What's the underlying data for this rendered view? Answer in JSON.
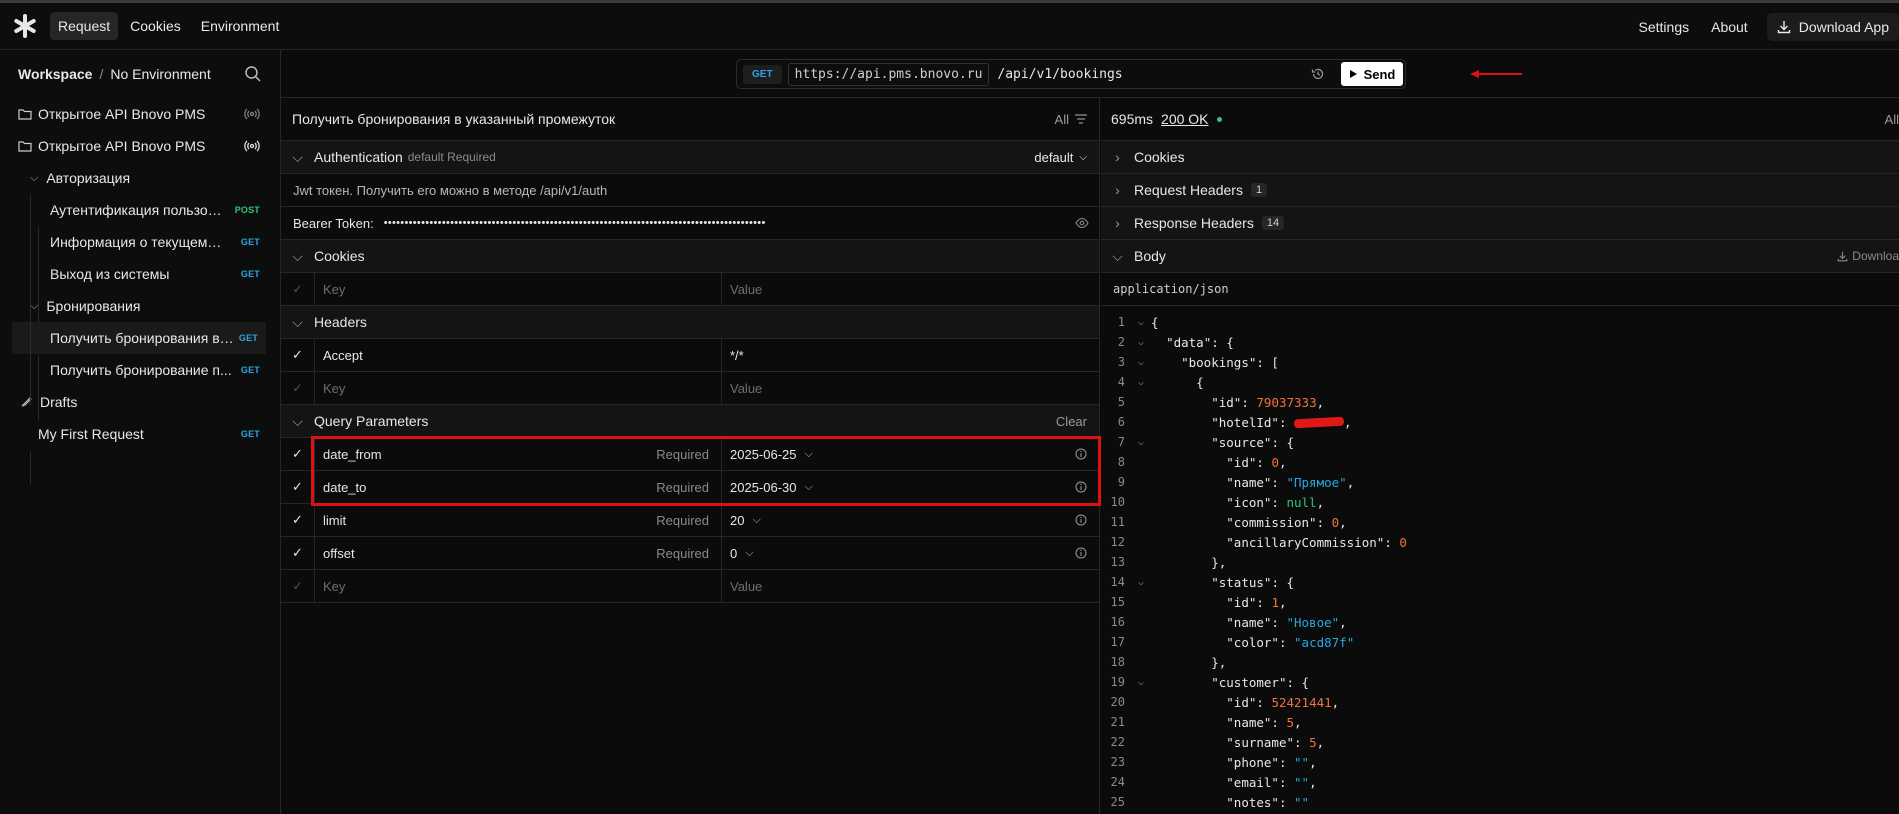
{
  "topbar": {
    "nav": [
      "Request",
      "Cookies",
      "Environment"
    ],
    "right": [
      "Settings",
      "About"
    ],
    "download_app": "Download App"
  },
  "sidebar": {
    "workspace": "Workspace",
    "separator": "/",
    "environment": "No Environment",
    "items": [
      {
        "label": "Открытое API Bnovo PMS",
        "type": "collection"
      },
      {
        "label": "Открытое API Bnovo PMS",
        "type": "collection"
      },
      {
        "label": "Авторизация",
        "type": "folder"
      },
      {
        "label": "Аутентификация пользов...",
        "method": "POST"
      },
      {
        "label": "Информация о текущем п...",
        "method": "GET"
      },
      {
        "label": "Выход из системы",
        "method": "GET"
      },
      {
        "label": "Бронирования",
        "type": "folder"
      },
      {
        "label": "Получить бронирования в ...",
        "method": "GET"
      },
      {
        "label": "Получить бронирование п...",
        "method": "GET"
      },
      {
        "label": "Drafts",
        "type": "drafts"
      },
      {
        "label": "My First Request",
        "method": "GET"
      }
    ]
  },
  "urlbar": {
    "method": "GET",
    "base": "https://api.pms.bnovo.ru",
    "path": "/api/v1/bookings",
    "send_label": "Send"
  },
  "request": {
    "title": "Получить бронирования в указанный промежуток",
    "filter_label": "All",
    "auth": {
      "title": "Authentication",
      "sub": "default Required",
      "mode": "default",
      "description": "Jwt токен. Получить его можно в методе /api/v1/auth",
      "bearer_label": "Bearer Token:",
      "bearer_value": "••••••••••••••••••••••••••••••••••••••••••••••••••••••••••••••••••••••••••••••••••••••••••••"
    },
    "cookies": {
      "title": "Cookies",
      "key_placeholder": "Key",
      "value_placeholder": "Value"
    },
    "headers": {
      "title": "Headers",
      "rows": [
        {
          "key": "Accept",
          "value": "*/*"
        }
      ],
      "key_placeholder": "Key",
      "value_placeholder": "Value"
    },
    "query": {
      "title": "Query Parameters",
      "clear_label": "Clear",
      "required_label": "Required",
      "rows": [
        {
          "key": "date_from",
          "value": "2025-06-25"
        },
        {
          "key": "date_to",
          "value": "2025-06-30"
        },
        {
          "key": "limit",
          "value": "20"
        },
        {
          "key": "offset",
          "value": "0"
        }
      ],
      "key_placeholder": "Key",
      "value_placeholder": "Value"
    }
  },
  "response": {
    "time": "695ms",
    "status": "200 OK",
    "filter_label": "All",
    "sections": {
      "cookies": "Cookies",
      "request_headers": "Request Headers",
      "request_headers_count": "1",
      "response_headers": "Response Headers",
      "response_headers_count": "14",
      "body": "Body",
      "download": "Downloa"
    },
    "content_type": "application/json",
    "json_lines": [
      {
        "n": "1",
        "fold": true,
        "indent": 0,
        "parts": [
          [
            "p",
            "{"
          ]
        ]
      },
      {
        "n": "2",
        "fold": true,
        "indent": 1,
        "parts": [
          [
            "k",
            "\"data\""
          ],
          [
            "p",
            ": {"
          ]
        ]
      },
      {
        "n": "3",
        "fold": true,
        "indent": 2,
        "parts": [
          [
            "k",
            "\"bookings\""
          ],
          [
            "p",
            ": ["
          ]
        ]
      },
      {
        "n": "4",
        "fold": true,
        "indent": 3,
        "parts": [
          [
            "p",
            "{"
          ]
        ]
      },
      {
        "n": "5",
        "fold": false,
        "indent": 4,
        "parts": [
          [
            "k",
            "\"id\""
          ],
          [
            "p",
            ": "
          ],
          [
            "n",
            "79037333"
          ],
          [
            "p",
            ","
          ]
        ]
      },
      {
        "n": "6",
        "fold": false,
        "indent": 4,
        "parts": [
          [
            "k",
            "\"hotelId\""
          ],
          [
            "p",
            ": "
          ],
          [
            "r",
            ""
          ],
          [
            "p",
            ","
          ]
        ]
      },
      {
        "n": "7",
        "fold": true,
        "indent": 4,
        "parts": [
          [
            "k",
            "\"source\""
          ],
          [
            "p",
            ": {"
          ]
        ]
      },
      {
        "n": "8",
        "fold": false,
        "indent": 5,
        "parts": [
          [
            "k",
            "\"id\""
          ],
          [
            "p",
            ": "
          ],
          [
            "n",
            "0"
          ],
          [
            "p",
            ","
          ]
        ]
      },
      {
        "n": "9",
        "fold": false,
        "indent": 5,
        "parts": [
          [
            "k",
            "\"name\""
          ],
          [
            "p",
            ": "
          ],
          [
            "s",
            "\"Прямое\""
          ],
          [
            "p",
            ","
          ]
        ]
      },
      {
        "n": "10",
        "fold": false,
        "indent": 5,
        "parts": [
          [
            "k",
            "\"icon\""
          ],
          [
            "p",
            ": "
          ],
          [
            "l",
            "null"
          ],
          [
            "p",
            ","
          ]
        ]
      },
      {
        "n": "11",
        "fold": false,
        "indent": 5,
        "parts": [
          [
            "k",
            "\"commission\""
          ],
          [
            "p",
            ": "
          ],
          [
            "n",
            "0"
          ],
          [
            "p",
            ","
          ]
        ]
      },
      {
        "n": "12",
        "fold": false,
        "indent": 5,
        "parts": [
          [
            "k",
            "\"ancillaryCommission\""
          ],
          [
            "p",
            ": "
          ],
          [
            "n",
            "0"
          ]
        ]
      },
      {
        "n": "13",
        "fold": false,
        "indent": 4,
        "parts": [
          [
            "p",
            "},"
          ]
        ]
      },
      {
        "n": "14",
        "fold": true,
        "indent": 4,
        "parts": [
          [
            "k",
            "\"status\""
          ],
          [
            "p",
            ": {"
          ]
        ]
      },
      {
        "n": "15",
        "fold": false,
        "indent": 5,
        "parts": [
          [
            "k",
            "\"id\""
          ],
          [
            "p",
            ": "
          ],
          [
            "n",
            "1"
          ],
          [
            "p",
            ","
          ]
        ]
      },
      {
        "n": "16",
        "fold": false,
        "indent": 5,
        "parts": [
          [
            "k",
            "\"name\""
          ],
          [
            "p",
            ": "
          ],
          [
            "s",
            "\"Новое\""
          ],
          [
            "p",
            ","
          ]
        ]
      },
      {
        "n": "17",
        "fold": false,
        "indent": 5,
        "parts": [
          [
            "k",
            "\"color\""
          ],
          [
            "p",
            ": "
          ],
          [
            "s",
            "\"acd87f\""
          ]
        ]
      },
      {
        "n": "18",
        "fold": false,
        "indent": 4,
        "parts": [
          [
            "p",
            "},"
          ]
        ]
      },
      {
        "n": "19",
        "fold": true,
        "indent": 4,
        "parts": [
          [
            "k",
            "\"customer\""
          ],
          [
            "p",
            ": {"
          ]
        ]
      },
      {
        "n": "20",
        "fold": false,
        "indent": 5,
        "parts": [
          [
            "k",
            "\"id\""
          ],
          [
            "p",
            ": "
          ],
          [
            "n",
            "52421441"
          ],
          [
            "p",
            ","
          ]
        ]
      },
      {
        "n": "21",
        "fold": false,
        "indent": 5,
        "parts": [
          [
            "k",
            "\"name\""
          ],
          [
            "p",
            ": "
          ],
          [
            "n",
            "5"
          ],
          [
            "p",
            ","
          ]
        ]
      },
      {
        "n": "22",
        "fold": false,
        "indent": 5,
        "parts": [
          [
            "k",
            "\"surname\""
          ],
          [
            "p",
            ": "
          ],
          [
            "n",
            "5"
          ],
          [
            "p",
            ","
          ]
        ]
      },
      {
        "n": "23",
        "fold": false,
        "indent": 5,
        "parts": [
          [
            "k",
            "\"phone\""
          ],
          [
            "p",
            ": "
          ],
          [
            "s",
            "\"\""
          ],
          [
            "p",
            ","
          ]
        ]
      },
      {
        "n": "24",
        "fold": false,
        "indent": 5,
        "parts": [
          [
            "k",
            "\"email\""
          ],
          [
            "p",
            ": "
          ],
          [
            "s",
            "\"\""
          ],
          [
            "p",
            ","
          ]
        ]
      },
      {
        "n": "25",
        "fold": false,
        "indent": 5,
        "parts": [
          [
            "k",
            "\"notes\""
          ],
          [
            "p",
            ": "
          ],
          [
            "s",
            "\"\""
          ]
        ]
      }
    ]
  },
  "colors": {
    "get": "#2aa7e0",
    "post": "#2fc47a",
    "highlight": "#dd1111",
    "number": "#f0733c"
  }
}
